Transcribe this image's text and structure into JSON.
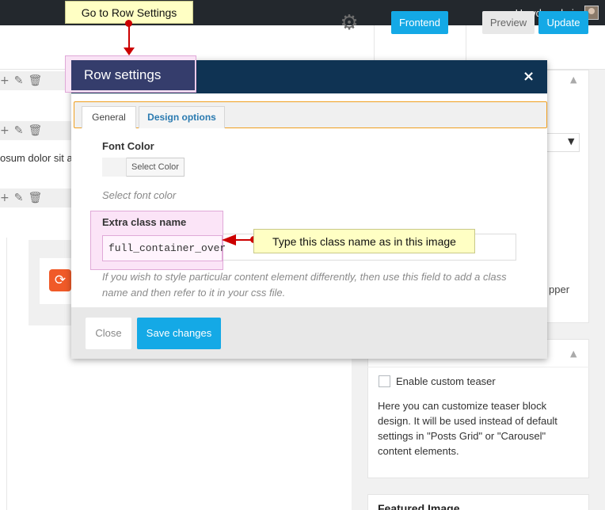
{
  "adminbar": {
    "greeting": "Howdy, admin"
  },
  "toolbar": {
    "frontend_label": "Frontend",
    "preview_label": "Preview",
    "update_label": "Update"
  },
  "content": {
    "lorem_fragment": "osum dolor sit a"
  },
  "sidebar": {
    "partial_text": "pper",
    "teaser": {
      "checkbox_label": "Enable custom teaser",
      "description": "Here you can customize teaser block design. It will be used instead of default settings in \"Posts Grid\" or \"Carousel\" content elements."
    },
    "featured_title": "Featured Image"
  },
  "modal": {
    "title": "Row settings",
    "close_glyph": "×",
    "tabs": [
      {
        "label": "General",
        "active": true
      },
      {
        "label": "Design options",
        "active": false
      }
    ],
    "font_color": {
      "label": "Font Color",
      "button_label": "Select Color",
      "help": "Select font color"
    },
    "extra_class": {
      "label": "Extra class name",
      "value": "full_container_over",
      "help": "If you wish to style particular content element differently, then use this field to add a class name and then refer to it in your css file."
    },
    "footer": {
      "close_label": "Close",
      "save_label": "Save changes"
    }
  },
  "callouts": {
    "go_to_row": "Go to Row Settings",
    "type_class": "Type this class name as in this image"
  },
  "colors": {
    "accent_blue": "#14a9e6",
    "modal_header": "#0f3353",
    "callout_yellow": "#ffffc4",
    "callout_pink": "#f9e3f5",
    "arrow_red": "#cc0000"
  }
}
